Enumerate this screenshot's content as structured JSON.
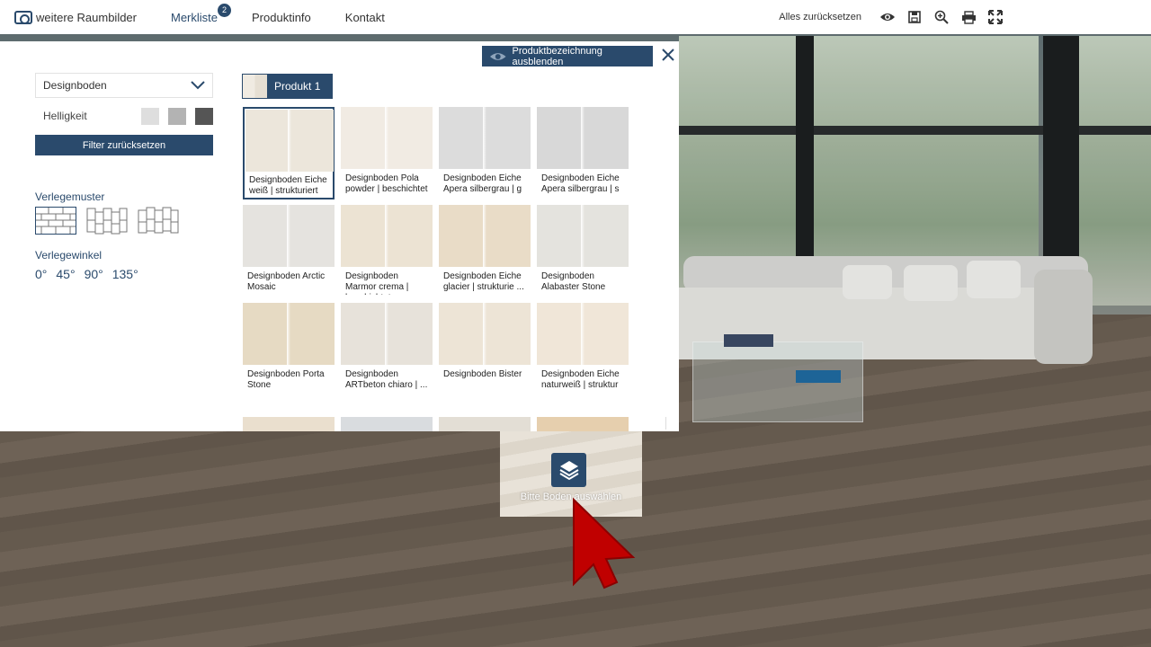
{
  "toolbar": {
    "room_images": "weitere Raumbilder",
    "wishlist": "Merkliste",
    "wishlist_count": "2",
    "product_info": "Produktinfo",
    "contact": "Kontakt",
    "reset_all": "Alles zurücksetzen",
    "icons": [
      "eye-icon",
      "save-icon",
      "zoom-in-icon",
      "print-icon",
      "fullscreen-icon"
    ]
  },
  "modal": {
    "hide_names_button": "Produktbezeichnung ausblenden",
    "category_select": "Designboden",
    "brightness_label": "Helligkeit",
    "filter_reset": "Filter zurücksetzen",
    "pattern_title": "Verlegemuster",
    "angle_title": "Verlegewinkel",
    "angles": [
      "0°",
      "45°",
      "90°",
      "135°"
    ],
    "product_tab": "Produkt 1",
    "products": [
      {
        "name": "Designboden Eiche weiß | strukturiert",
        "color": "#ece6db",
        "selected": true
      },
      {
        "name": "Designboden Pola powder | beschichtet",
        "color": "#f1ebe3",
        "selected": false
      },
      {
        "name": "Designboden Eiche Apera silbergrau | g ...",
        "color": "#dcdcdc",
        "selected": false
      },
      {
        "name": "Designboden Eiche Apera silbergrau | s ...",
        "color": "#d8d8d8",
        "selected": false
      },
      {
        "name": "Designboden Arctic Mosaic",
        "color": "#e5e3df",
        "selected": false
      },
      {
        "name": "Designboden Marmor crema | beschichtet ...",
        "color": "#ece3d3",
        "selected": false
      },
      {
        "name": "Designboden Eiche glacier | strukturie ...",
        "color": "#e9dcc7",
        "selected": false
      },
      {
        "name": "Designboden Alabaster Stone",
        "color": "#e4e3de",
        "selected": false
      },
      {
        "name": "Designboden Porta Stone",
        "color": "#e6dac3",
        "selected": false
      },
      {
        "name": "Designboden ARTbeton chiaro | ...",
        "color": "#e7e2da",
        "selected": false
      },
      {
        "name": "Designboden Bister",
        "color": "#ede4d6",
        "selected": false
      },
      {
        "name": "Designboden Eiche naturweiß | struktur ...",
        "color": "#f0e6d8",
        "selected": false
      }
    ],
    "partial_row_colors": [
      "#eadfce",
      "#d9dcdf",
      "#e3ded5",
      "#e6cfae"
    ]
  },
  "floor_picker": {
    "label": "Bitte Boden auswählen"
  }
}
